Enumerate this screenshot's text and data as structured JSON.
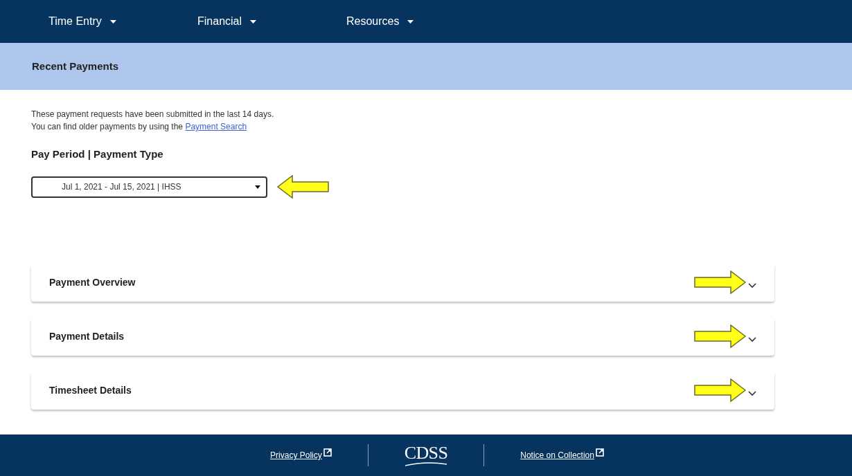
{
  "nav": {
    "items": [
      {
        "label": "Time Entry"
      },
      {
        "label": "Financial"
      },
      {
        "label": "Resources"
      }
    ]
  },
  "page_title": "Recent Payments",
  "intro": {
    "line_1": "These payment requests have been submitted in the last 14 days.",
    "line_2": "You can find older payments by using the ",
    "link": "Payment Search"
  },
  "pay_period": {
    "label": "Pay Period | Payment Type",
    "value": "Jul 1, 2021 - Jul 15, 2021 | IHSS"
  },
  "sections": [
    {
      "title": "Payment Overview",
      "expanded": false
    },
    {
      "title": "Payment Details",
      "expanded": false
    },
    {
      "title": "Timesheet Details",
      "expanded": false
    }
  ],
  "footer": {
    "links": [
      "Privacy Policy",
      "Notice on Collection"
    ],
    "logo": "CDSS"
  }
}
